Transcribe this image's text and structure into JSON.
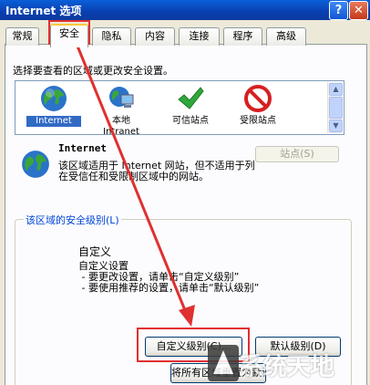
{
  "window": {
    "title": "Internet 选项",
    "help_label": "?",
    "close_label": "✕"
  },
  "tabs": [
    {
      "label": "常规"
    },
    {
      "label": "安全",
      "active": true
    },
    {
      "label": "隐私"
    },
    {
      "label": "内容"
    },
    {
      "label": "连接"
    },
    {
      "label": "程序"
    },
    {
      "label": "高级"
    }
  ],
  "security": {
    "instruction": "选择要查看的区域或更改安全设置。",
    "zones": [
      {
        "label": "Internet",
        "icon": "globe-icon",
        "selected": true
      },
      {
        "label": "本地\nIntranet",
        "icon": "computer-network-icon"
      },
      {
        "label": "可信站点",
        "icon": "check-icon"
      },
      {
        "label": "受限站点",
        "icon": "prohibited-icon"
      }
    ],
    "zone_name": "Internet",
    "zone_desc": "该区域适用于 Internet 网站，但不适用于列在受信任和受限制区域中的网站。",
    "sites_button": "站点(S)",
    "group_title": "该区域的安全级别(L)",
    "level_name": "自定义",
    "level_desc": "自定义设置\n - 要更改设置，请单击“自定义级别”\n - 要使用推荐的设置，请单击“默认级别”",
    "custom_level_button": "自定义级别(C)...",
    "default_level_button": "默认级别(D)",
    "reset_button": "将所有区域重置为默认级别(R)"
  },
  "annotation_color": "#e03030",
  "watermark": {
    "text": "系统天地"
  }
}
